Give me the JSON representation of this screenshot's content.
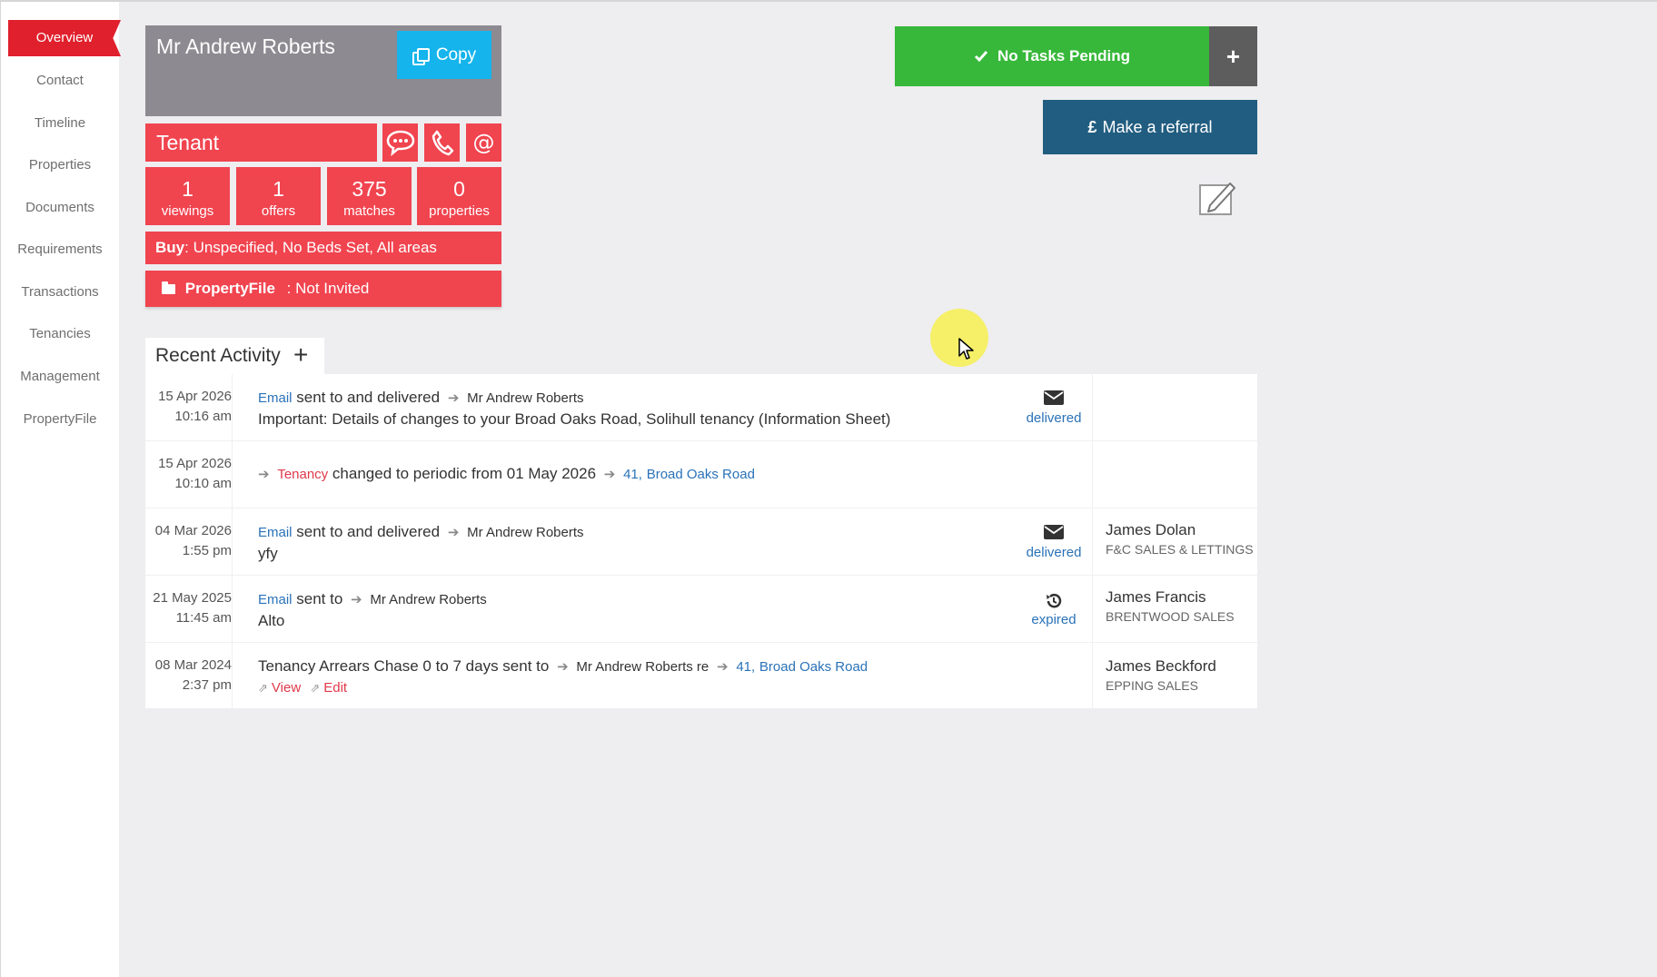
{
  "sidebar": {
    "items": [
      {
        "label": "Overview",
        "active": true
      },
      {
        "label": "Contact"
      },
      {
        "label": "Timeline"
      },
      {
        "label": "Properties"
      },
      {
        "label": "Documents"
      },
      {
        "label": "Requirements"
      },
      {
        "label": "Transactions"
      },
      {
        "label": "Tenancies"
      },
      {
        "label": "Management"
      },
      {
        "label": "PropertyFile"
      }
    ]
  },
  "contact": {
    "name": "Mr Andrew Roberts",
    "copy_label": "Copy",
    "role": "Tenant",
    "icons": [
      "sms-icon",
      "phone-icon",
      "email-icon"
    ],
    "stats": [
      {
        "value": "1",
        "label": "viewings"
      },
      {
        "value": "1",
        "label": "offers"
      },
      {
        "value": "375",
        "label": "matches"
      },
      {
        "value": "0",
        "label": "properties"
      }
    ],
    "requirement_type": "Buy",
    "requirement_text": ": Unspecified, No Beds Set, All areas",
    "propertyfile_brand": "PropertyFile",
    "propertyfile_status": ": Not Invited"
  },
  "actions": {
    "tasks_label": "No Tasks Pending",
    "tasks_add": "+",
    "referral_symbol": "£",
    "referral_label": "Make a referral"
  },
  "activity": {
    "title": "Recent Activity",
    "add": "+",
    "rows": [
      {
        "date": "15 Apr 2026",
        "time": "10:16 am",
        "type": "Email",
        "text": "sent to and delivered",
        "recipient": "Mr Andrew Roberts",
        "subject": "Important: Details of changes to your Broad Oaks Road, Solihull tenancy (Information Sheet)",
        "status": "delivered",
        "status_icon": "envelope-icon",
        "agent": "",
        "office": ""
      },
      {
        "date": "15 Apr 2026",
        "time": "10:10 am",
        "type": "Tenancy",
        "text": "changed to periodic from 01 May 2026",
        "property_num": "41,",
        "property": "Broad Oaks Road"
      },
      {
        "date": "04 Mar 2026",
        "time": "1:55 pm",
        "type": "Email",
        "text": "sent to and delivered",
        "recipient": "Mr Andrew Roberts",
        "subject": "yfy",
        "status": "delivered",
        "status_icon": "envelope-icon",
        "agent": "James Dolan",
        "office": "F&C SALES & LETTINGS"
      },
      {
        "date": "21 May 2025",
        "time": "11:45 am",
        "type": "Email",
        "text": "sent to",
        "recipient": "Mr Andrew Roberts",
        "subject": "Alto",
        "status": "expired",
        "status_icon": "history-icon",
        "agent": "James Francis",
        "office": "BRENTWOOD SALES"
      },
      {
        "date": "08 Mar 2024",
        "time": "2:37 pm",
        "text": "Tenancy Arrears Chase 0 to 7 days sent to",
        "recipient": "Mr Andrew Roberts re",
        "property_num": "41,",
        "property": "Broad Oaks Road",
        "view_label": "View",
        "edit_label": "Edit",
        "agent": "James Beckford",
        "office": "EPPING SALES"
      }
    ]
  },
  "colors": {
    "brand_red": "#f0444f",
    "active_nav": "#e0202c",
    "copy_blue": "#15b4ec",
    "tasks_green": "#37b83a",
    "referral_blue": "#215d80",
    "link_blue": "#2a72b8"
  }
}
